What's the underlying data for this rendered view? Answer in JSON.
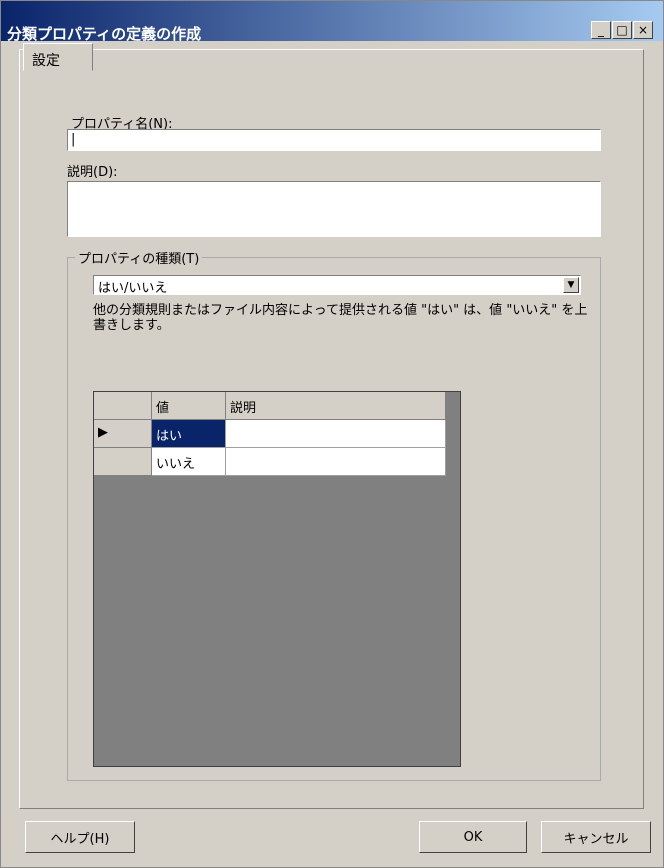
{
  "window": {
    "title": "分類プロパティの定義の作成"
  },
  "title_buttons": {
    "minimize": "_",
    "maximize": "□",
    "close": "×"
  },
  "tabs": [
    {
      "label": "設定"
    }
  ],
  "fields": {
    "name_label": "プロパティ名(N):",
    "name_value": "|",
    "desc_label": "説明(D):"
  },
  "group": {
    "title": "プロパティの種類(T)",
    "select_value": "はい/いいえ",
    "description": "他の分類規則またはファイル内容によって提供される値 \"はい\" は、値 \"いいえ\" を上書きします。"
  },
  "grid": {
    "headers": [
      "値",
      "説明"
    ],
    "rows": [
      {
        "marker": "▶",
        "value": "はい",
        "desc": ""
      },
      {
        "marker": "",
        "value": "いいえ",
        "desc": ""
      }
    ]
  },
  "buttons": {
    "help": "ヘルプ(H)",
    "ok": "OK",
    "cancel": "キャンセル"
  }
}
